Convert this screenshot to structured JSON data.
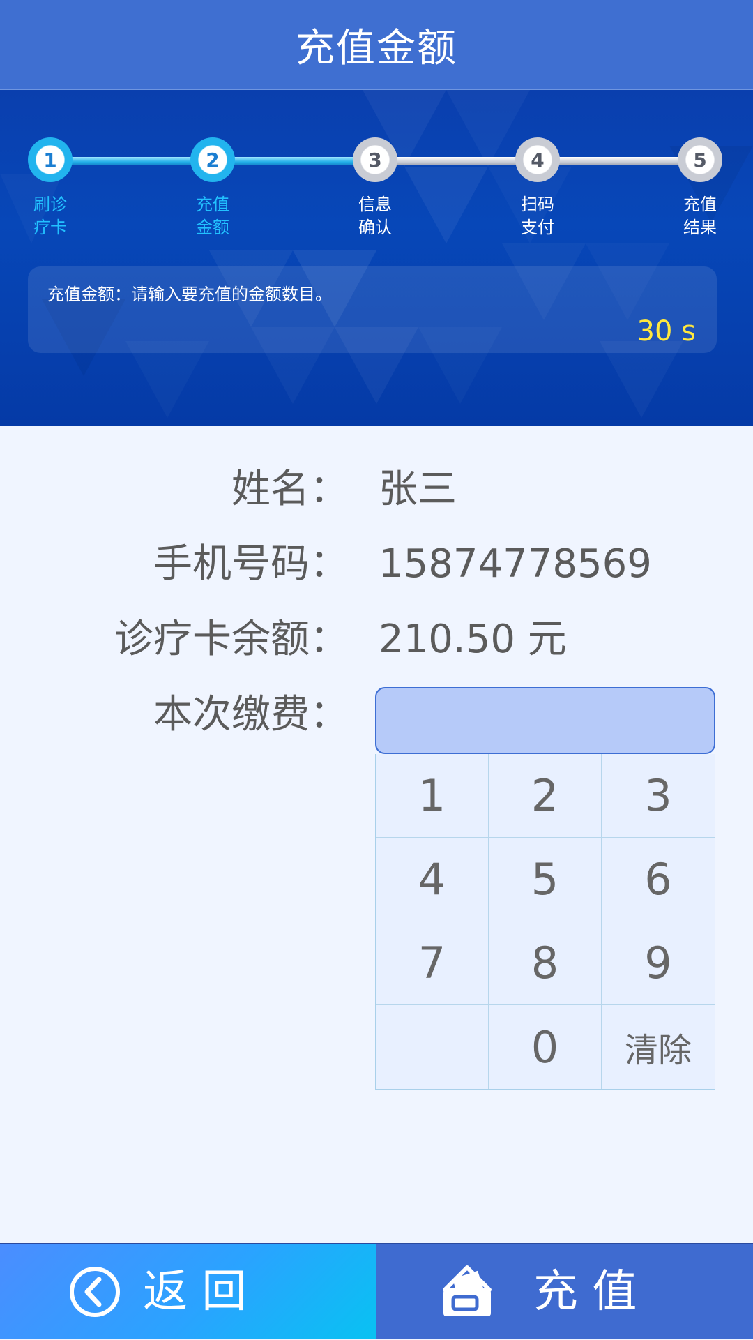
{
  "header": {
    "title": "充值金额"
  },
  "steps": [
    {
      "num": "1",
      "label": "刷诊\n疗卡",
      "state": "done"
    },
    {
      "num": "2",
      "label": "充值\n金额",
      "state": "done"
    },
    {
      "num": "3",
      "label": "信息\n确认",
      "state": "todo"
    },
    {
      "num": "4",
      "label": "扫码\n支付",
      "state": "todo"
    },
    {
      "num": "5",
      "label": "充值\n结果",
      "state": "todo"
    }
  ],
  "tip": {
    "text": "充值金额：请输入要充值的金额数目。",
    "countdown": "30  s"
  },
  "info": {
    "name_label": "姓名：",
    "name_value": "张三",
    "phone_label": "手机号码：",
    "phone_value": "15874778569",
    "balance_label": "诊疗卡余额：",
    "balance_value": "210.50 元",
    "payment_label": "本次缴费："
  },
  "amount_input": {
    "value": "",
    "placeholder": ""
  },
  "keypad": {
    "keys": [
      "1",
      "2",
      "3",
      "4",
      "5",
      "6",
      "7",
      "8",
      "9",
      "",
      "0",
      "清除"
    ]
  },
  "buttons": {
    "back_label": "返   回",
    "charge_label": "充   值"
  },
  "colors": {
    "header": "#3f6fd1",
    "banner": "#0747b8",
    "step_done": "#22b4ee",
    "countdown": "#ffe83d",
    "input_bg": "#b6caf9"
  },
  "icons": {
    "back": "back-chevron-circle-icon",
    "charge": "wallet-card-icon"
  }
}
